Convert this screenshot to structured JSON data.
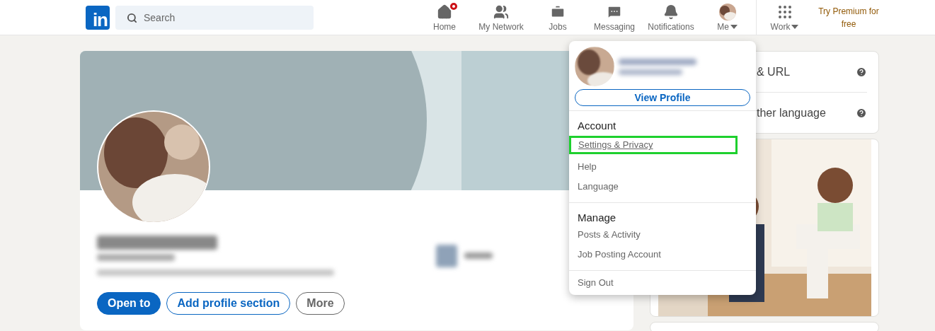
{
  "header": {
    "logo": "in",
    "search": {
      "placeholder": "Search"
    },
    "nav": [
      {
        "kind": "home",
        "label": "Home",
        "badge": true,
        "caret": false
      },
      {
        "kind": "network",
        "label": "My Network",
        "badge": false,
        "caret": false
      },
      {
        "kind": "jobs",
        "label": "Jobs",
        "badge": false,
        "caret": false
      },
      {
        "kind": "messaging",
        "label": "Messaging",
        "badge": false,
        "caret": false
      },
      {
        "kind": "notifications",
        "label": "Notifications",
        "badge": false,
        "caret": false
      },
      {
        "kind": "me",
        "label": "Me",
        "badge": false,
        "caret": true
      }
    ],
    "work": {
      "label": "Work",
      "caret": true
    },
    "premium": "Try Premium for free"
  },
  "profile": {
    "buttons": [
      {
        "kind": "primary",
        "label": "Open to"
      },
      {
        "kind": "outline",
        "label": "Add profile section"
      },
      {
        "kind": "muted",
        "label": "More"
      }
    ]
  },
  "sidebar": {
    "settings": [
      {
        "label": "& URL"
      },
      {
        "label": "ther language"
      }
    ]
  },
  "menu": {
    "view_profile": "View Profile",
    "sections": [
      {
        "title": "Account",
        "items": [
          {
            "label": "Settings & Privacy",
            "highlighted": true
          },
          {
            "label": "Help",
            "highlighted": false
          },
          {
            "label": "Language",
            "highlighted": false
          }
        ]
      },
      {
        "title": "Manage",
        "items": [
          {
            "label": "Posts & Activity",
            "highlighted": false
          },
          {
            "label": "Job Posting Account",
            "highlighted": false
          }
        ]
      }
    ],
    "footer": "Sign Out"
  }
}
